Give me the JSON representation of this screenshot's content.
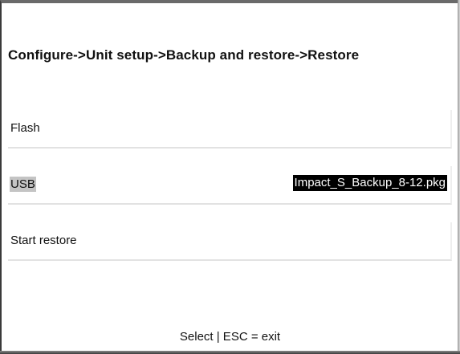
{
  "header": {
    "breadcrumb": "Configure->Unit setup->Backup and restore->Restore"
  },
  "menu": {
    "items": [
      {
        "label": "Flash"
      },
      {
        "label": "USB",
        "value": "Impact_S_Backup_8-12.pkg"
      },
      {
        "label": "Start restore"
      }
    ]
  },
  "footer": {
    "hint": "Select | ESC = exit"
  }
}
